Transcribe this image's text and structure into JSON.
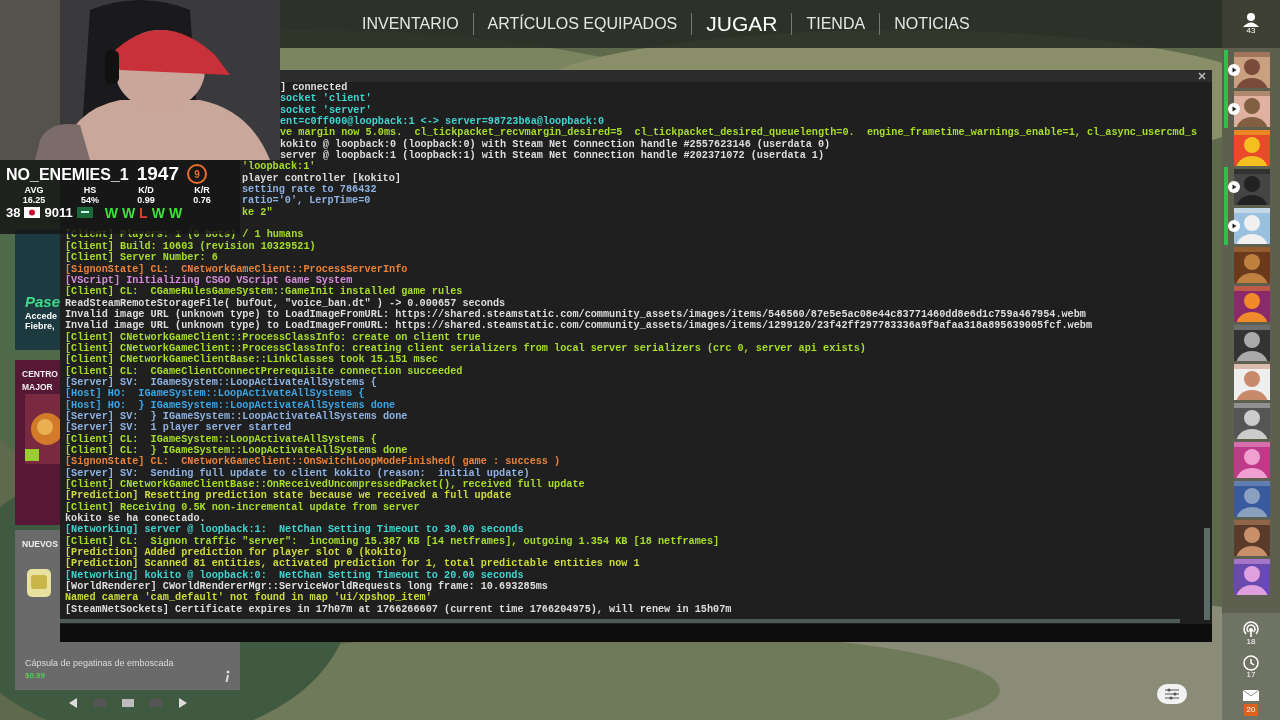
{
  "nav": {
    "items": [
      {
        "label": "INVENTARIO",
        "selected": false
      },
      {
        "label": "ARTÍCULOS EQUIPADOS",
        "selected": false
      },
      {
        "label": "JUGAR",
        "selected": true
      },
      {
        "label": "TIENDA",
        "selected": false
      },
      {
        "label": "NOTICIAS",
        "selected": false
      }
    ]
  },
  "stats": {
    "player": "NO_ENEMIES_1",
    "rating": "1947",
    "rank": "9",
    "columns": [
      {
        "label": "AVG",
        "value": "16.25"
      },
      {
        "label": "HS",
        "value": "54%"
      },
      {
        "label": "K/D",
        "value": "0.99"
      },
      {
        "label": "K/R",
        "value": "0.76"
      }
    ],
    "number_1": "38",
    "number_2": "9011",
    "results": [
      {
        "label": "W",
        "win": true
      },
      {
        "label": "W",
        "win": true
      },
      {
        "label": "L",
        "win": false
      },
      {
        "label": "W",
        "win": true
      },
      {
        "label": "W",
        "win": true
      }
    ]
  },
  "left_panel": {
    "promo_title": "Pase",
    "promo_lines": [
      "Accede",
      "Fiebre,"
    ],
    "event_lines": [
      "CENTRO",
      "MAJOR"
    ],
    "store_heading": "NUEVOS",
    "store_item": "Cápsula de pegatinas de emboscada",
    "store_price": "$0.99",
    "carousel": [
      {
        "selected": false
      },
      {
        "selected": true
      },
      {
        "selected": false
      }
    ]
  },
  "console": {
    "lines_behind_webcam": [
      {
        "kind": "plain",
        "text": "] connected"
      },
      {
        "kind": "networking",
        "text": "socket 'client'"
      },
      {
        "kind": "networking",
        "text": "socket 'server'"
      },
      {
        "kind": "networking",
        "text": "ent=c0ff000@loopback:1 <-> server=98723b6a@loopback:0"
      },
      {
        "kind": "client",
        "text": "ve margin now 5.0ms.  cl_tickpacket_recvmargin_desired=5  cl_tickpacket_desired_queuelength=0.  engine_frametime_warnings_enable=1, cl_async_usercmd_s"
      },
      {
        "kind": "plain",
        "text": "kokito @ loopback:0 (loopback:0) with Steam Net Connection handle #2557623146 (userdata 0)"
      },
      {
        "kind": "plain",
        "text": "server @ loopback:1 (loopback:1) with Steam Net Connection handle #202371072 (userdata 1)"
      }
    ],
    "lines_behind_stats": [
      {
        "kind": "client",
        "text": "'loopback:1'"
      },
      {
        "kind": "plain",
        "text": "player controller [kokito]"
      },
      {
        "kind": "server",
        "text": "setting rate to 786432"
      },
      {
        "kind": "server",
        "text": "ratio='0', LerpTime=0"
      },
      {
        "kind": "client",
        "text": "ke 2\""
      }
    ],
    "lines": [
      {
        "kind": "client",
        "text": "[Client] Players: 1 (0 bots) / 1 humans"
      },
      {
        "kind": "client",
        "text": "[Client] Build: 10603 (revision 10329521)"
      },
      {
        "kind": "client",
        "text": "[Client] Server Number: 6"
      },
      {
        "kind": "signon",
        "text": "[SignonState] CL:  CNetworkGameClient::ProcessServerInfo"
      },
      {
        "kind": "vscript",
        "text": "[VScript] Initializing CSGO VScript Game System"
      },
      {
        "kind": "client",
        "text": "[Client] CL:  CGameRulesGameSystem::GameInit installed game rules"
      },
      {
        "kind": "plain",
        "text": "ReadSteamRemoteStorageFile( bufOut, \"voice_ban.dt\" ) -> 0.000657 seconds"
      },
      {
        "kind": "plain",
        "text": "Invalid image URL (unknown type) to LoadImageFromURL: https://shared.steamstatic.com/community_assets/images/items/546560/87e5e5ac08e44c83771460dd8e6d1c759a467954.webm"
      },
      {
        "kind": "plain",
        "text": "Invalid image URL (unknown type) to LoadImageFromURL: https://shared.steamstatic.com/community_assets/images/items/1299120/23f42ff297783336a9f9afaa318a895639005fcf.webm"
      },
      {
        "kind": "client",
        "text": "[Client] CNetworkGameClient::ProcessClassInfo: create on client true"
      },
      {
        "kind": "client",
        "text": "[Client] CNetworkGameClient::ProcessClassInfo: creating client serializers from local server serializers (crc 0, server api exists)"
      },
      {
        "kind": "client",
        "text": "[Client] CNetworkGameClientBase::LinkClasses took 15.151 msec"
      },
      {
        "kind": "client",
        "text": "[Client] CL:  CGameClientConnectPrerequisite connection succeeded"
      },
      {
        "kind": "server",
        "text": "[Server] SV:  IGameSystem::LoopActivateAllSystems {"
      },
      {
        "kind": "host",
        "text": "[Host] HO:  IGameSystem::LoopActivateAllSystems {"
      },
      {
        "kind": "host",
        "text": "[Host] HO:  } IGameSystem::LoopActivateAllSystems done"
      },
      {
        "kind": "server",
        "text": "[Server] SV:  } IGameSystem::LoopActivateAllSystems done"
      },
      {
        "kind": "server",
        "text": "[Server] SV:  1 player server started"
      },
      {
        "kind": "client",
        "text": "[Client] CL:  IGameSystem::LoopActivateAllSystems {"
      },
      {
        "kind": "client",
        "text": "[Client] CL:  } IGameSystem::LoopActivateAllSystems done"
      },
      {
        "kind": "signon",
        "text": "[SignonState] CL:  CNetworkGameClient::OnSwitchLoopModeFinished( game : success )"
      },
      {
        "kind": "server",
        "text": "[Server] SV:  Sending full update to client kokito (reason:  initial update)"
      },
      {
        "kind": "client",
        "text": "[Client] CNetworkGameClientBase::OnReceivedUncompressedPacket(), received full update"
      },
      {
        "kind": "prediction",
        "text": "[Prediction] Resetting prediction state because we received a full update"
      },
      {
        "kind": "client",
        "text": "[Client] Receiving 0.5K non-incremental update from server"
      },
      {
        "kind": "plain",
        "text": "kokito se ha conectado."
      },
      {
        "kind": "networking",
        "text": "[Networking] server @ loopback:1:  NetChan Setting Timeout to 30.00 seconds"
      },
      {
        "kind": "client",
        "text": "[Client] CL:  Signon traffic \"server\":  incoming 15.387 KB [14 netframes], outgoing 1.354 KB [18 netframes]"
      },
      {
        "kind": "prediction",
        "text": "[Prediction] Added prediction for player slot 0 (kokito)"
      },
      {
        "kind": "prediction",
        "text": "[Prediction] Scanned 81 entities, activated prediction for 1, total predictable entities now 1"
      },
      {
        "kind": "networking",
        "text": "[Networking] kokito @ loopback:0:  NetChan Setting Timeout to 20.00 seconds"
      },
      {
        "kind": "plain",
        "text": "[WorldRenderer] CWorldRendererMgr::ServiceWorldRequests long frame: 10.693285ms"
      },
      {
        "kind": "prediction",
        "text": "Named camera 'cam_default' not found in map 'ui/xpshop_item'"
      },
      {
        "kind": "plain",
        "text": "[SteamNetSockets] Certificate expires in 17h07m at 1766266607 (current time 1766204975), will renew in 15h07m"
      }
    ]
  },
  "sidebar": {
    "friends_online": "43",
    "friends": [
      {
        "in_game": true
      },
      {
        "in_game": true
      },
      {
        "in_game": false
      },
      {
        "in_game": true
      },
      {
        "in_game": true
      },
      {
        "in_game": false
      },
      {
        "in_game": false
      },
      {
        "in_game": false
      },
      {
        "in_game": false
      },
      {
        "in_game": false
      },
      {
        "in_game": false
      },
      {
        "in_game": false
      },
      {
        "in_game": false
      },
      {
        "in_game": false
      }
    ],
    "bottom": [
      {
        "kind": "broadcast",
        "count": "18"
      },
      {
        "kind": "history",
        "count": "17"
      },
      {
        "kind": "mail",
        "count": "20"
      }
    ]
  }
}
